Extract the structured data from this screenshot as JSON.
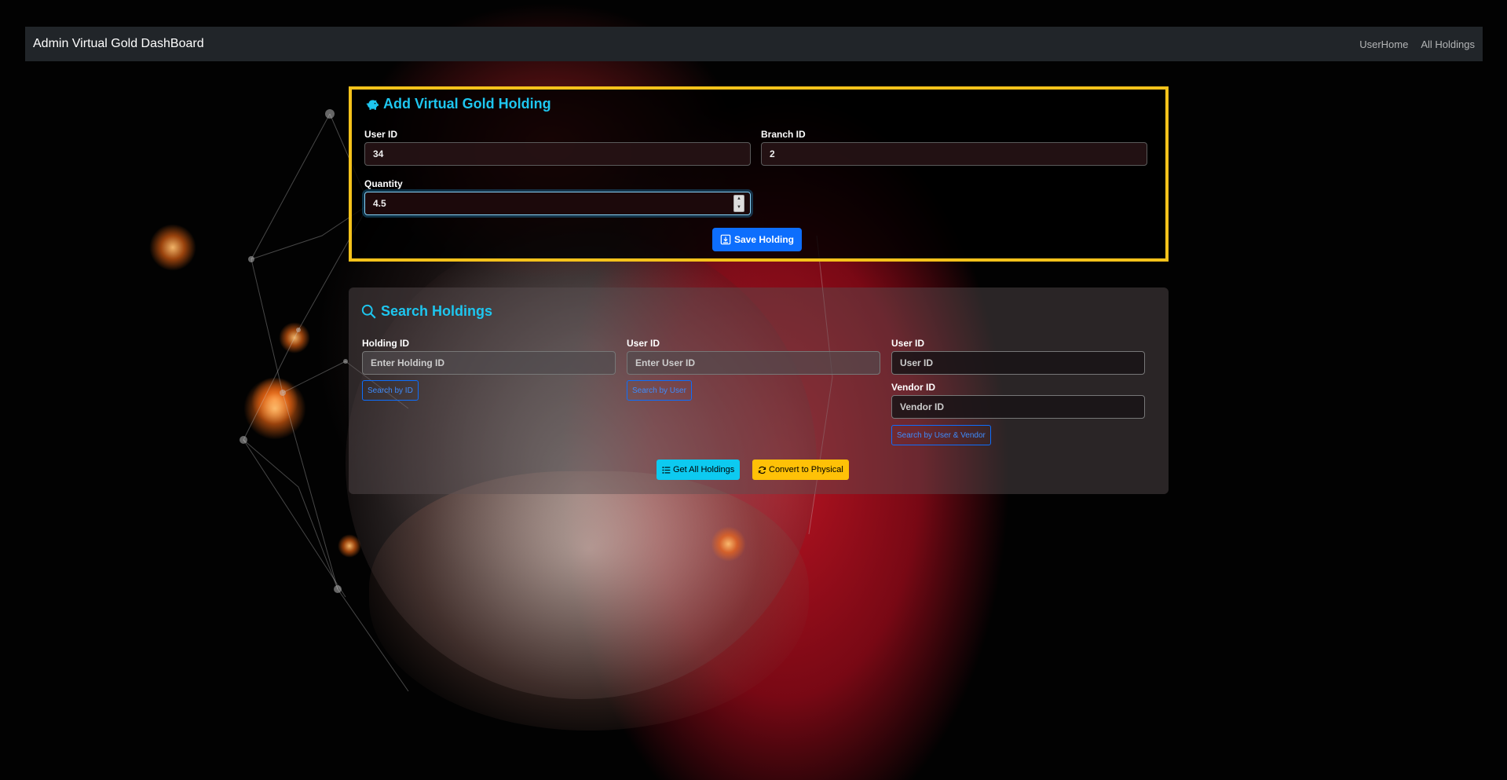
{
  "navbar": {
    "brand": "Admin Virtual Gold DashBoard",
    "links": [
      "UserHome",
      "All Holdings"
    ]
  },
  "add_holding": {
    "title": "Add Virtual Gold Holding",
    "title_icon": "piggy-bank-icon",
    "user_id_label": "User ID",
    "user_id_value": "34",
    "branch_id_label": "Branch ID",
    "branch_id_value": "2",
    "quantity_label": "Quantity",
    "quantity_value": "4.5",
    "save_label": "Save Holding",
    "save_icon": "save-icon"
  },
  "search_holdings": {
    "title": "Search Holdings",
    "title_icon": "search-icon",
    "holding_id_label": "Holding ID",
    "holding_id_placeholder": "Enter Holding ID",
    "search_by_id_label": "Search by ID",
    "user_id_label": "User ID",
    "user_id_placeholder": "Enter User ID",
    "search_by_user_label": "Search by User",
    "user_id2_label": "User ID",
    "user_id2_placeholder": "User ID",
    "vendor_id_label": "Vendor ID",
    "vendor_id_placeholder": "Vendor ID",
    "search_by_user_vendor_label": "Search by User & Vendor",
    "get_all_label": "Get All Holdings",
    "convert_label": "Convert to Physical"
  },
  "colors": {
    "accent_title": "#1ec6ef",
    "highlight_border": "#f5c21b",
    "primary": "#0d6efd",
    "info": "#0dcaf0",
    "warning": "#ffc107",
    "navbar_bg": "#212529"
  }
}
